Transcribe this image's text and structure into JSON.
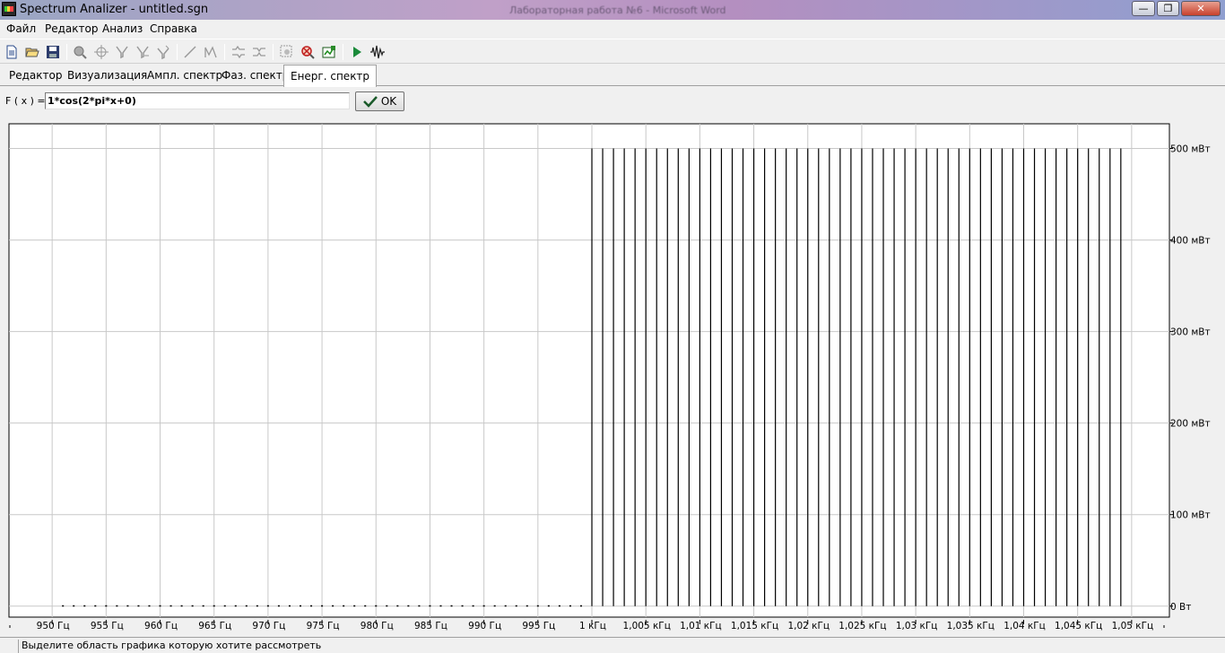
{
  "window": {
    "title": "Spectrum Analizer - untitled.sgn",
    "background_title": "Лабораторная работа №6 - Microsoft Word",
    "buttons": {
      "minimize": "—",
      "maximize": "❐",
      "close": "✕"
    }
  },
  "menu": [
    "Файл",
    "Редактор",
    "Анализ",
    "Справка"
  ],
  "toolbar": {
    "icons": [
      "new-file-icon",
      "open-folder-icon",
      "save-disk-icon",
      "zoom-icon",
      "crosshair-icon",
      "filter-icon",
      "filter-2-icon",
      "filter-3-icon",
      "line-icon",
      "envelope-icon",
      "wave-swap-icon",
      "wave-swap-2-icon",
      "zoom-area-icon",
      "zoom-reset-icon",
      "export-icon",
      "play-icon",
      "waveform-icon"
    ]
  },
  "tabs": [
    "Редактор",
    "Визуализация",
    "Ампл. спектр",
    "Фаз. спектр",
    "Енерг. спектр"
  ],
  "active_tab": 4,
  "formula": {
    "label": "F ( x ) =",
    "value": "1*cos(2*pi*x+0)",
    "ok_label": "OK"
  },
  "status": {
    "text": "Выделите область графика которую хотите рассмотреть"
  },
  "chart_data": {
    "type": "bar",
    "x_tick_labels": [
      "950 Гц",
      "955 Гц",
      "960 Гц",
      "965 Гц",
      "970 Гц",
      "975 Гц",
      "980 Гц",
      "985 Гц",
      "990 Гц",
      "995 Гц",
      "1 кГц",
      "1,005 кГц",
      "1,01 кГц",
      "1,015 кГц",
      "1,02 кГц",
      "1,025 кГц",
      "1,03 кГц",
      "1,035 кГц",
      "1,04 кГц",
      "1,045 кГц",
      "1,05 кГц"
    ],
    "x_ticks": [
      950,
      955,
      960,
      965,
      970,
      975,
      980,
      985,
      990,
      995,
      1000,
      1005,
      1010,
      1015,
      1020,
      1025,
      1030,
      1035,
      1040,
      1045,
      1050
    ],
    "y_tick_labels": [
      "0 Вт",
      "100 мВт",
      "200 мВт",
      "300 мВт",
      "400 мВт",
      "500 мВт"
    ],
    "y_ticks": [
      0,
      100,
      200,
      300,
      400,
      500
    ],
    "xlim": [
      946,
      1053.5
    ],
    "ylim": [
      -12,
      527
    ],
    "xunit": "Гц",
    "yunit": "мВт",
    "grid": true,
    "zero_x": [
      951,
      952,
      953,
      954,
      955,
      956,
      957,
      958,
      959,
      960,
      961,
      962,
      963,
      964,
      965,
      966,
      967,
      968,
      969,
      970,
      971,
      972,
      973,
      974,
      975,
      976,
      977,
      978,
      979,
      980,
      981,
      982,
      983,
      984,
      985,
      986,
      987,
      988,
      989,
      990,
      991,
      992,
      993,
      994,
      995,
      996,
      997,
      998,
      999
    ],
    "peak_x": [
      1000,
      1001,
      1002,
      1003,
      1004,
      1005,
      1006,
      1007,
      1008,
      1009,
      1010,
      1011,
      1012,
      1013,
      1014,
      1015,
      1016,
      1017,
      1018,
      1019,
      1020,
      1021,
      1022,
      1023,
      1024,
      1025,
      1026,
      1027,
      1028,
      1029,
      1030,
      1031,
      1032,
      1033,
      1034,
      1035,
      1036,
      1037,
      1038,
      1039,
      1040,
      1041,
      1042,
      1043,
      1044,
      1045,
      1046,
      1047,
      1048,
      1049
    ],
    "peak_value": 500
  }
}
